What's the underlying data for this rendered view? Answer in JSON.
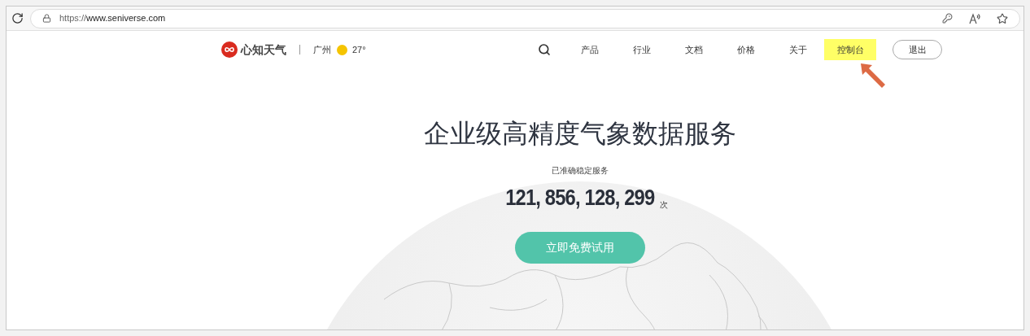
{
  "browser": {
    "url_prefix": "https://",
    "url_host": "www.seniverse.com"
  },
  "header": {
    "brand": "心知天气",
    "city": "广州",
    "temperature": "27°",
    "nav": [
      {
        "label": "产品",
        "highlighted": false
      },
      {
        "label": "行业",
        "highlighted": false
      },
      {
        "label": "文档",
        "highlighted": false
      },
      {
        "label": "价格",
        "highlighted": false
      },
      {
        "label": "关于",
        "highlighted": false
      },
      {
        "label": "控制台",
        "highlighted": true
      }
    ],
    "logout": "退出"
  },
  "hero": {
    "title": "企业级高精度气象数据服务",
    "subtitle": "已准确稳定服务",
    "count": "121, 856, 128, 299",
    "count_unit": "次",
    "cta": "立即免费试用"
  }
}
